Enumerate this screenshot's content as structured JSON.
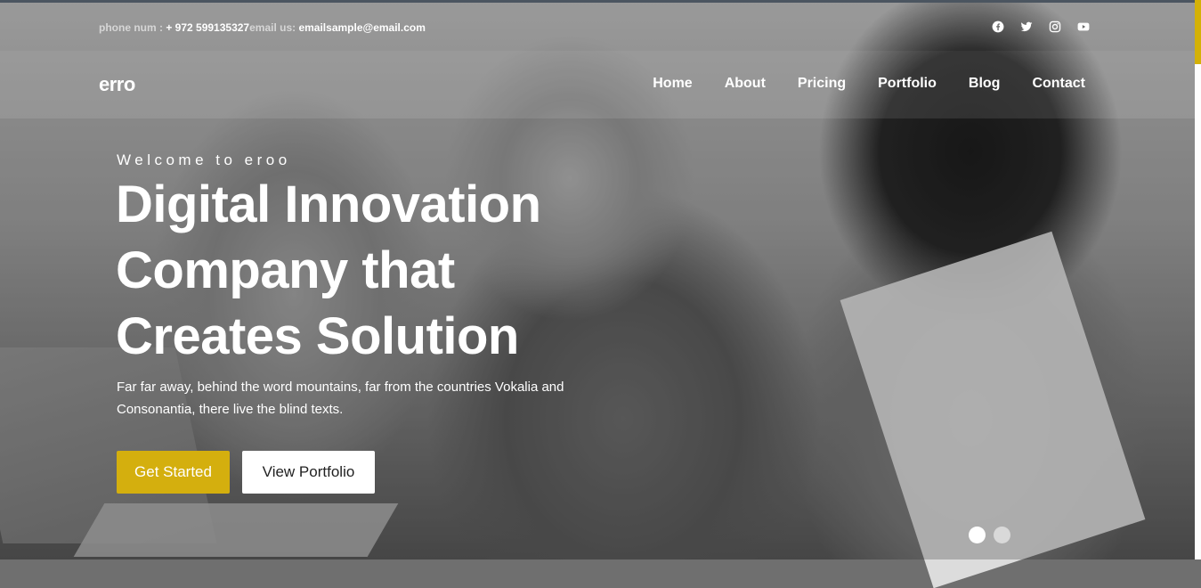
{
  "topbar": {
    "phone_label": "phone num : ",
    "phone_value": "+ 972 599135327",
    "email_label": "email us: ",
    "email_value": "emailsample@email.com",
    "social_icons": [
      "facebook-icon",
      "twitter-icon",
      "instagram-icon",
      "youtube-icon"
    ]
  },
  "navbar": {
    "logo": "erro",
    "links": [
      "Home",
      "About",
      "Pricing",
      "Portfolio",
      "Blog",
      "Contact"
    ]
  },
  "hero": {
    "eyebrow": "Welcome to eroo",
    "headline_lines": [
      "Digital Innovation",
      "Company that",
      "Creates Solution"
    ],
    "description": "Far far away, behind the word mountains, far from the countries Vokalia and Consonantia, there live the blind texts.",
    "primary_button": "Get Started",
    "secondary_button": "View Portfolio"
  },
  "slider": {
    "active_index": 0,
    "dot_count": 2
  },
  "colors": {
    "accent": "#d4af0e",
    "text": "#ffffff",
    "scroll_thumb": "#d4b106"
  }
}
